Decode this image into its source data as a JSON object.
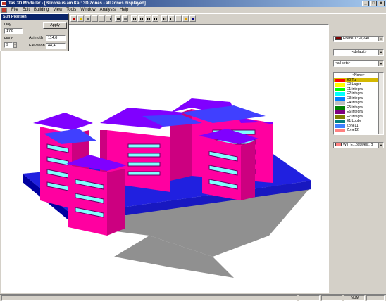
{
  "window": {
    "title": "Tas 3D Modeller - [Bürohaus am Kai: 3D Zones - all zones displayed]",
    "controls": [
      "_",
      "□",
      "×"
    ]
  },
  "menu": [
    "File",
    "Edit",
    "Building",
    "View",
    "Tools",
    "Window",
    "Analysis",
    "Help"
  ],
  "sun_panel": {
    "title": "Sun Position",
    "day_label": "Day",
    "day_value": "172",
    "hour_label": "Hour",
    "hour_value": "9",
    "apply_label": "Apply",
    "azimuth_label": "Azimuth",
    "azimuth_value": "114,0",
    "elevation_label": "Elevation",
    "elevation_value": "44,4"
  },
  "right_panel": {
    "level_select": "Ebene 1 : -0,240",
    "level_color": "#800000",
    "view_select": "<default>",
    "zone_set_select": "<all sets>",
    "zones": [
      {
        "name": "<None>",
        "color": "#ffffff"
      },
      {
        "name": "E0 Tiz",
        "color": "#ff0000",
        "selected": true
      },
      {
        "name": "E0 Lager",
        "color": "#ffff00"
      },
      {
        "name": "E1 integral",
        "color": "#00ff00"
      },
      {
        "name": "E2 integral",
        "color": "#00ffff"
      },
      {
        "name": "E3 integral",
        "color": "#0080ff"
      },
      {
        "name": "E4 integral",
        "color": "#c0c0c0"
      },
      {
        "name": "E5 integral",
        "color": "#008000"
      },
      {
        "name": "E6 integral",
        "color": "#800080"
      },
      {
        "name": "E7 integral",
        "color": "#808000"
      },
      {
        "name": "E1 Lobby",
        "color": "#008080"
      },
      {
        "name": "Zone11",
        "color": "#4080ff"
      },
      {
        "name": "Zone12",
        "color": "#ff8080"
      }
    ],
    "construction_select": "WT_E1.ost/west. B",
    "construction_color": "#ff8080"
  },
  "status": {
    "num": "NUM"
  },
  "colors": {
    "roof": "#8000ff",
    "wall": "#ff00a0",
    "glass": "#80ffff",
    "base": "#2020e0",
    "shadow": "#909090"
  }
}
